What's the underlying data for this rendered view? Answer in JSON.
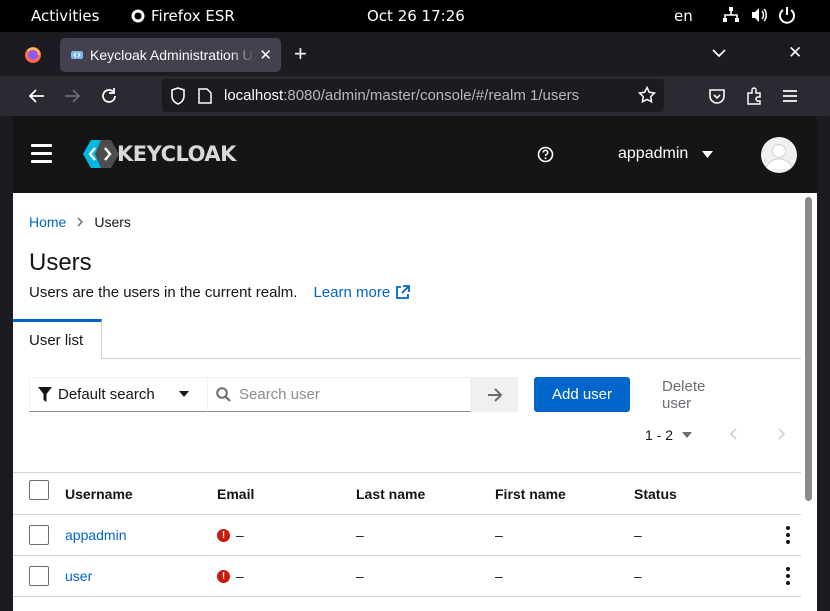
{
  "system": {
    "activities": "Activities",
    "app_name": "Firefox ESR",
    "clock": "Oct 26  17:26",
    "language": "en"
  },
  "browser": {
    "tab_title": "Keycloak Administration UI",
    "url_host": "localhost",
    "url_path": ":8080/admin/master/console/#/realm 1/users"
  },
  "header": {
    "logo_text": "KEYCLOAK",
    "username": "appadmin"
  },
  "breadcrumb": {
    "home": "Home",
    "current": "Users"
  },
  "page": {
    "title": "Users",
    "description": "Users are the users in the current realm.",
    "learn_more": "Learn more"
  },
  "tabs": {
    "user_list": "User list"
  },
  "toolbar": {
    "filter_label": "Default search",
    "search_placeholder": "Search user",
    "add_user": "Add user",
    "delete_user": "Delete user"
  },
  "pagination": {
    "range": "1 - 2"
  },
  "table": {
    "columns": [
      "Username",
      "Email",
      "Last name",
      "First name",
      "Status"
    ],
    "rows": [
      {
        "username": "appadmin",
        "email": "–",
        "last_name": "–",
        "first_name": "–",
        "status": "–"
      },
      {
        "username": "user",
        "email": "–",
        "last_name": "–",
        "first_name": "–",
        "status": "–"
      }
    ]
  },
  "colors": {
    "accent": "#0066cc",
    "header_bg": "#151515",
    "error": "#c9190b"
  }
}
